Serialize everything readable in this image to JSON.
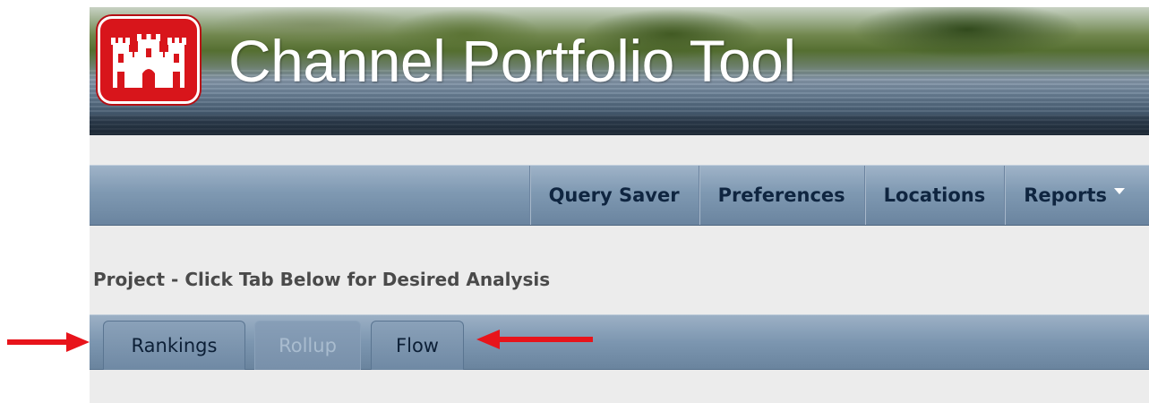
{
  "header": {
    "app_title": "Channel Portfolio Tool",
    "logo_icon": "castle-icon",
    "brand_color": "#d8151b"
  },
  "nav": {
    "items": [
      {
        "label": "Query Saver"
      },
      {
        "label": "Preferences"
      },
      {
        "label": "Locations"
      },
      {
        "label": "Reports",
        "icon": "caret-down-icon"
      }
    ]
  },
  "project": {
    "heading": "Project - Click Tab Below for Desired Analysis"
  },
  "tabs": [
    {
      "label": "Rankings",
      "state": "enabled"
    },
    {
      "label": "Rollup",
      "state": "disabled"
    },
    {
      "label": "Flow",
      "state": "enabled"
    }
  ],
  "annotations": {
    "arrow_color": "#e8141b",
    "arrow_icon": "arrow-icon"
  }
}
